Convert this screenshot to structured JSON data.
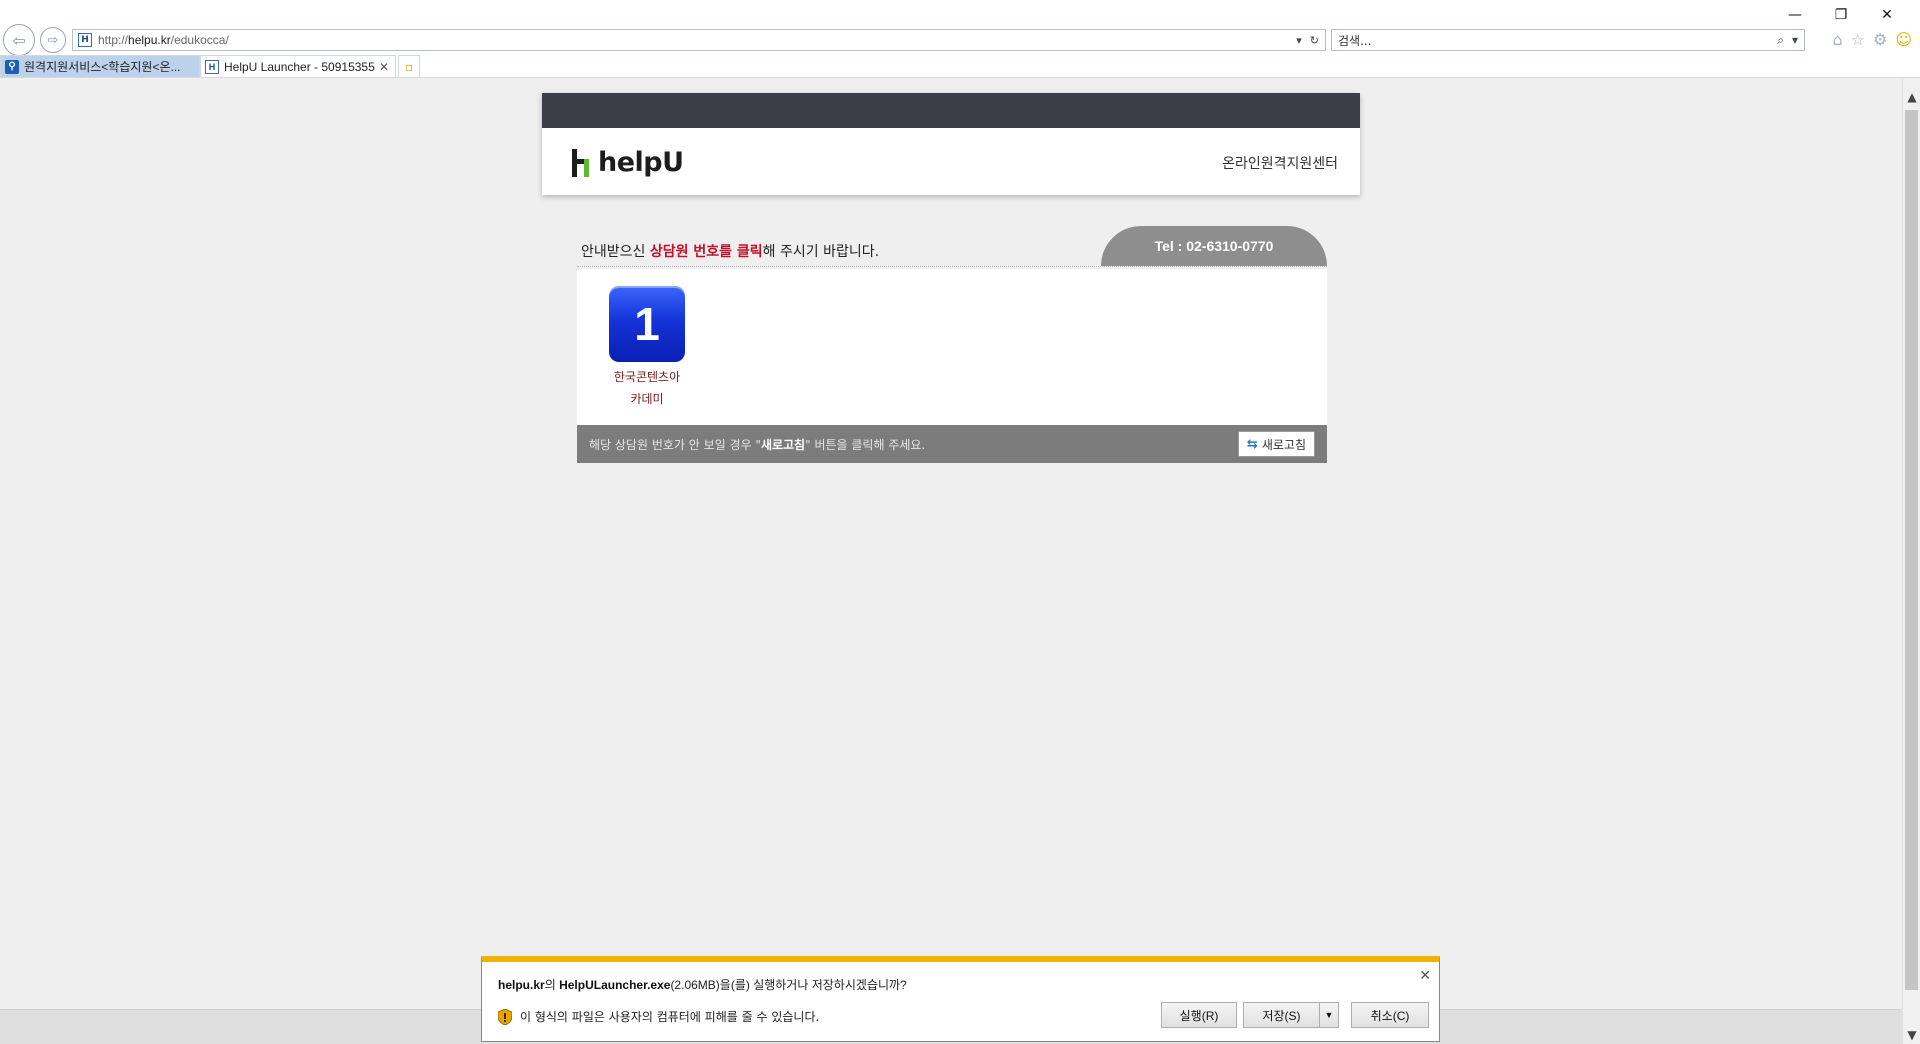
{
  "browser": {
    "window_controls": {
      "minimize": "—",
      "restore": "❐",
      "close": "✕"
    },
    "nav": {
      "back_glyph": "⇦",
      "forward_glyph": "⇨"
    },
    "address": {
      "prefix": "http://",
      "host": "helpu.kr",
      "path": "/edukocca/",
      "favicon": "H"
    },
    "address_tail": {
      "dropdown": "▾",
      "refresh": "↻"
    },
    "search": {
      "placeholder": "검색...",
      "icon": "⌕",
      "dropdown": "▾"
    },
    "tools": {
      "home": "⌂",
      "favorites": "☆",
      "settings": "⚙",
      "feedback": "☺"
    },
    "tabs": [
      {
        "label": "원격지원서비스<학습지원<온...",
        "icon": "pin",
        "active": false
      },
      {
        "label": "HelpU Launcher - 50915355",
        "icon": "H",
        "active": true,
        "close": "✕"
      }
    ],
    "new_tab_glyph": "▫"
  },
  "site": {
    "logo_text": "helpU",
    "header_right": "온라인원격지원센터",
    "instruction": {
      "pre": "안내받으신 ",
      "highlight": "상담원 번호를 클릭",
      "post": "해 주시기 바랍니다."
    },
    "tel": "Tel : 02-6310-0770",
    "counselors": [
      {
        "number": "1",
        "name_line1": "한국콘텐츠아",
        "name_line2": "카데미"
      }
    ],
    "footer": {
      "pre": "해당 상담원 번호가 안 보일 경우 \"",
      "bold": "새로고침",
      "post": "\" 버튼을 클릭해 주세요."
    },
    "refresh_button": {
      "icon": "⇆",
      "label": "새로고침"
    }
  },
  "scrollbar": {
    "up": "▲",
    "down": "▼"
  },
  "download_bar": {
    "host": "helpu.kr",
    "q_mid": "의 ",
    "file": "HelpULauncher.exe",
    "q_rest": "(2.06MB)을(를) 실행하거나 저장하시겠습니까?",
    "warning": "이 형식의 파일은 사용자의 컴퓨터에 피해를 줄 수 있습니다.",
    "close": "✕",
    "buttons": {
      "run": "실행(R)",
      "save": "저장(S)",
      "save_arrow": "▼",
      "cancel": "취소(C)"
    },
    "accent_color": "#f0b400"
  }
}
